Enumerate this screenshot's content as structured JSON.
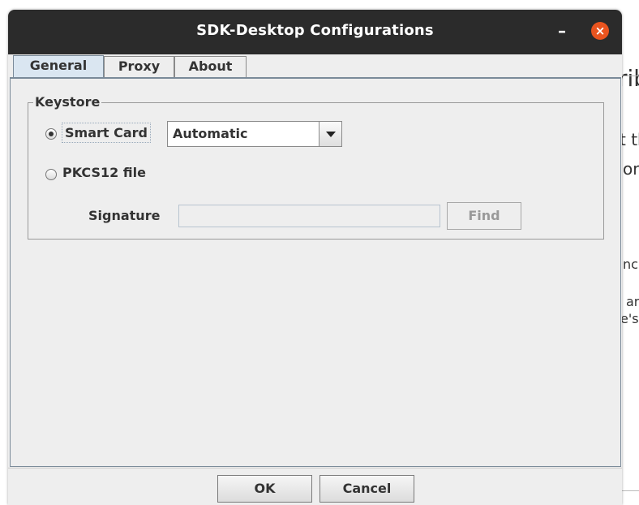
{
  "background": {
    "fragments": [
      "rib",
      "t th",
      "or",
      "nc",
      "ar",
      "e's"
    ]
  },
  "window": {
    "title": "SDK-Desktop Configurations",
    "minimize_glyph": "–",
    "close_glyph": "×"
  },
  "tabs": [
    {
      "label": "General",
      "active": true
    },
    {
      "label": "Proxy",
      "active": false
    },
    {
      "label": "About",
      "active": false
    }
  ],
  "keystore": {
    "group_title": "Keystore",
    "smart_card_label": "Smart Card",
    "smart_card_selected": true,
    "smart_card_mode": "Automatic",
    "pkcs12_label": "PKCS12 file",
    "pkcs12_selected": false,
    "signature_label": "Signature",
    "signature_value": "",
    "find_label": "Find"
  },
  "footer": {
    "ok_label": "OK",
    "cancel_label": "Cancel"
  },
  "colors": {
    "titlebar": "#2b2b2b",
    "close": "#e9541f",
    "active_tab": "#dae6f1",
    "panel": "#eeeeee"
  }
}
